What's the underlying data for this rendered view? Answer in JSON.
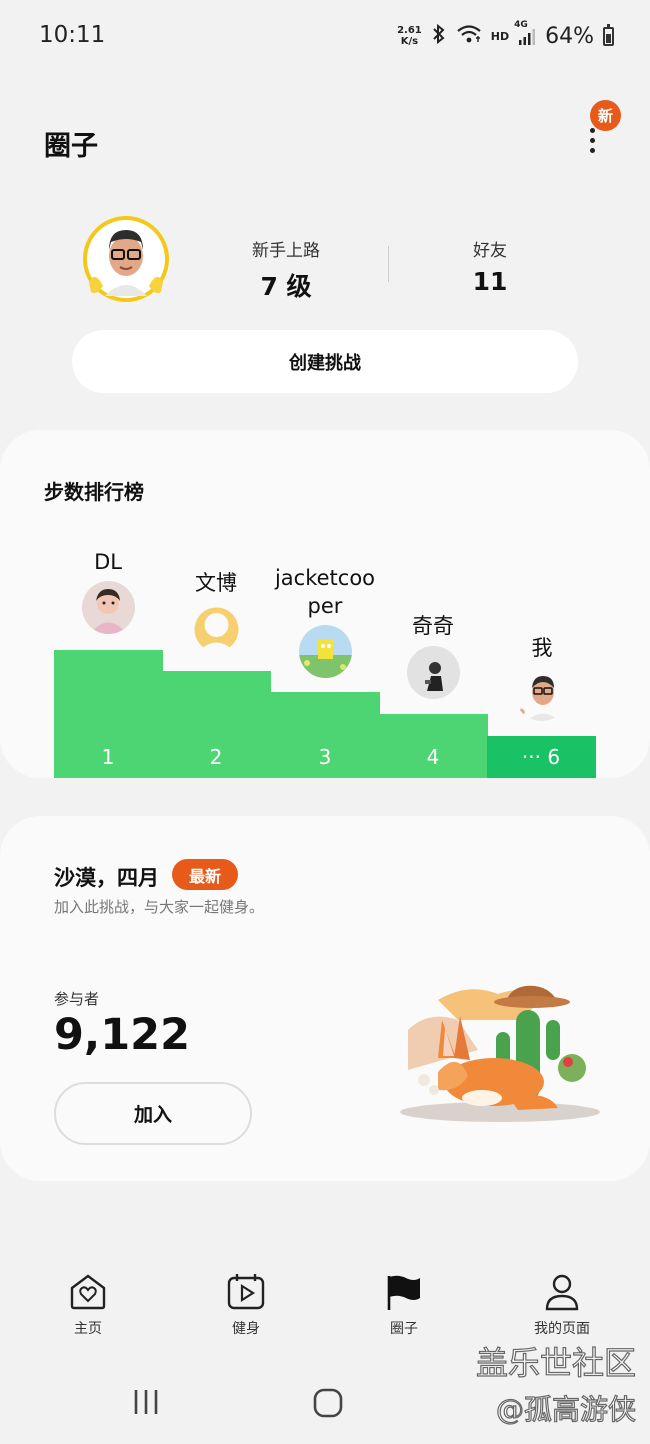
{
  "status": {
    "time": "10:11",
    "net_speed_value": "2.61",
    "net_speed_unit": "K/s",
    "network_type": "4G",
    "hd_label": "HD",
    "battery": "64%"
  },
  "header": {
    "title": "圈子",
    "new_badge": "新"
  },
  "profile": {
    "level_label": "新手上路",
    "level_value": "7 级",
    "friends_label": "好友",
    "friends_value": "11",
    "create_button": "创建挑战"
  },
  "leaderboard": {
    "title": "步数排行榜",
    "players": [
      {
        "name": "DL",
        "rank": "1"
      },
      {
        "name": "文博",
        "rank": "2"
      },
      {
        "name": "jacketcoo\nper",
        "rank": "3"
      },
      {
        "name": "奇奇",
        "rank": "4"
      },
      {
        "name": "我",
        "rank": "··· 6"
      }
    ]
  },
  "challenge": {
    "title": "沙漠，四月",
    "badge": "最新",
    "subtitle": "加入此挑战，与大家一起健身。",
    "participants_label": "参与者",
    "participants_value": "9,122",
    "join_button": "加入"
  },
  "bottom_nav": {
    "items": [
      {
        "label": "主页",
        "icon": "home-heart-icon"
      },
      {
        "label": "健身",
        "icon": "workout-play-icon"
      },
      {
        "label": "圈子",
        "icon": "flag-icon"
      },
      {
        "label": "我的页面",
        "icon": "person-icon"
      }
    ]
  },
  "watermark": {
    "line1": "盖乐世社区",
    "line2": "@孤高游侠"
  },
  "colors": {
    "accent_orange": "#e85a19",
    "bar_green": "#4ed573",
    "bar_green_me": "#19c265",
    "avatar_ring": "#f3c81a"
  }
}
